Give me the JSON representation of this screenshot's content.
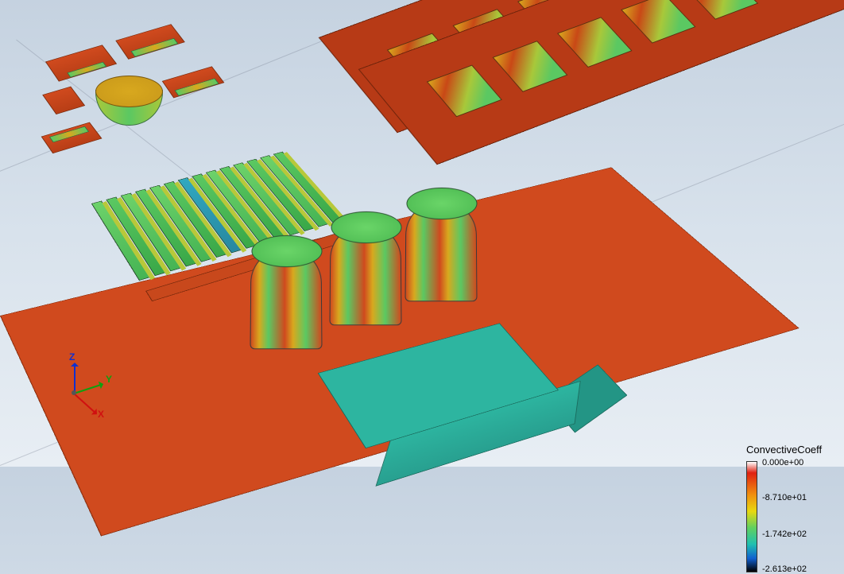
{
  "legend": {
    "title": "ConvectiveCoeff",
    "ticks": [
      {
        "label": "0.000e+00",
        "pos": 18
      },
      {
        "label": "-8.710e+01",
        "pos": 62
      },
      {
        "label": "-1.742e+02",
        "pos": 108
      },
      {
        "label": "-2.613e+02",
        "pos": 152
      }
    ]
  },
  "axes": {
    "x": "X",
    "y": "Y",
    "z": "Z"
  },
  "colors": {
    "board": "#d04a1e",
    "heatsink_fin": "#5bc862",
    "capacitor_top": "#6ad568",
    "box_top": "#2db5a0",
    "ram_board": "#b73a16"
  },
  "components": {
    "heatsink_fins": 14,
    "capacitors": 3,
    "ram_modules": 2,
    "chips_per_module": 6,
    "connector_parts": 5
  }
}
